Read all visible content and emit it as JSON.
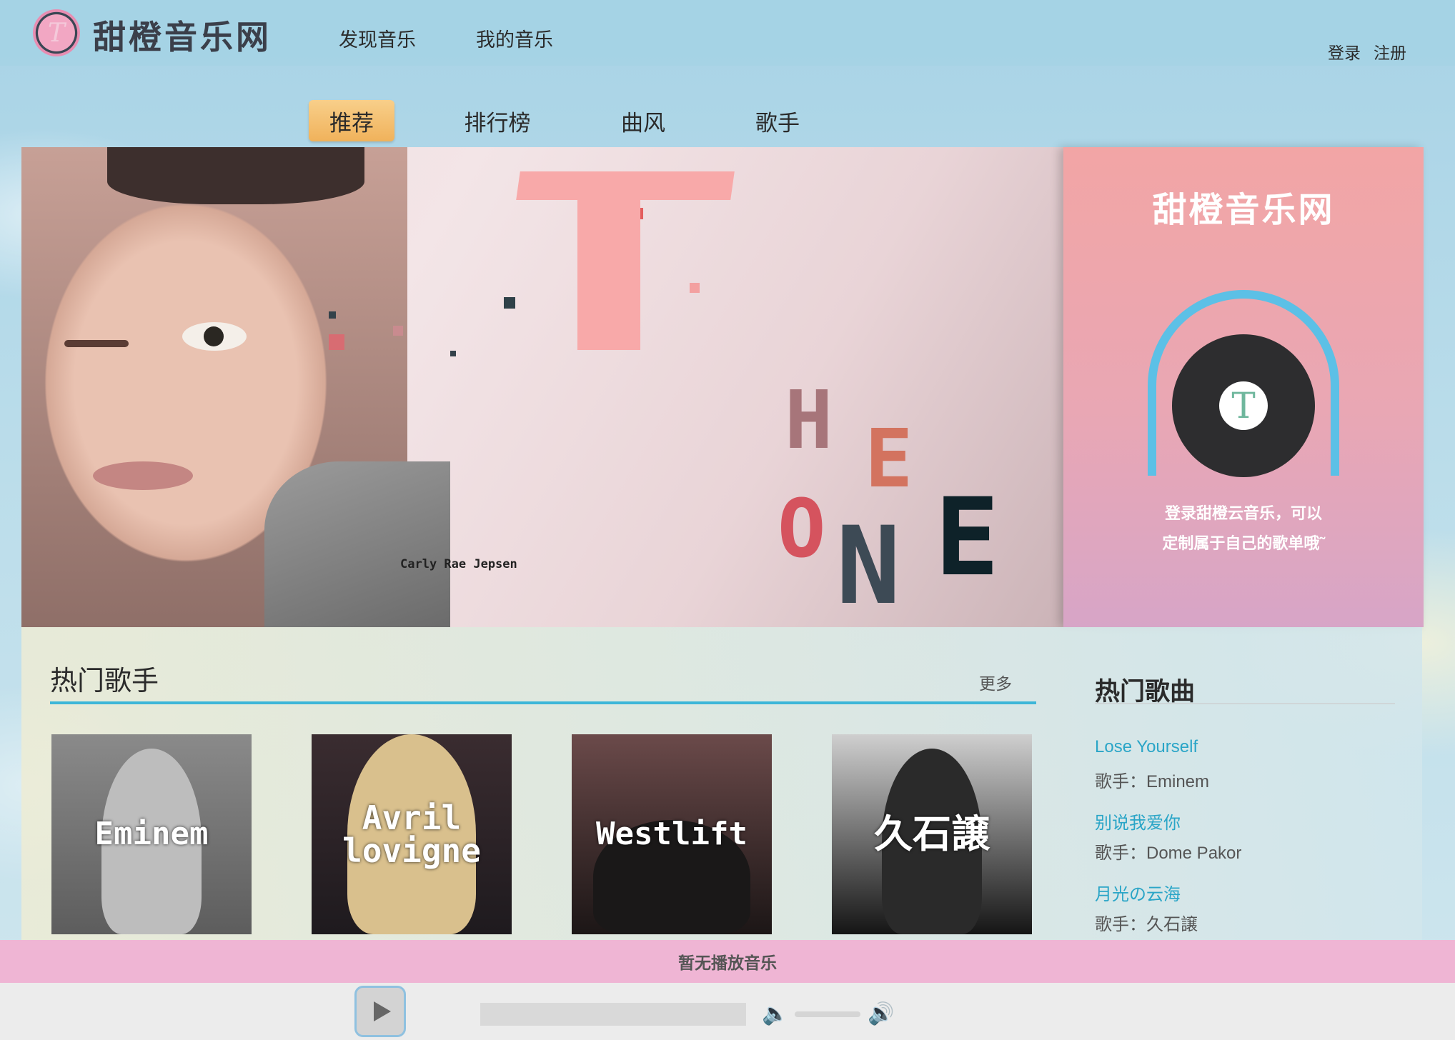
{
  "brand": {
    "name": "甜橙音乐网",
    "logo_letter": "T"
  },
  "topnav": {
    "items": [
      "发现音乐",
      "我的音乐"
    ],
    "login": "登录",
    "register": "注册"
  },
  "tabs": [
    {
      "label": "推荐",
      "active": true
    },
    {
      "label": "排行榜",
      "active": false
    },
    {
      "label": "曲风",
      "active": false
    },
    {
      "label": "歌手",
      "active": false
    }
  ],
  "banner": {
    "letters": [
      "T",
      "H",
      "E",
      "O",
      "N",
      "E"
    ],
    "credit": "Carly Rae Jepsen"
  },
  "promo": {
    "title": "甜橙音乐网",
    "line1": "登录甜橙云音乐，可以",
    "line2": "定制属于自己的歌单哦˜",
    "vinyl_letter": "T"
  },
  "hot_singers": {
    "title": "热门歌手",
    "more": "更多",
    "items": [
      {
        "name": "Eminem"
      },
      {
        "name": "Avril lovigne"
      },
      {
        "name": "Westlift"
      },
      {
        "name": "久石譲"
      }
    ]
  },
  "hot_songs": {
    "title": "热门歌曲",
    "items": [
      {
        "title": "Lose Yourself",
        "artist": "歌手：Eminem"
      },
      {
        "title": "别说我爱你",
        "artist": "歌手：Dome Pakor"
      },
      {
        "title": "月光の云海",
        "artist": "歌手：久石譲"
      }
    ]
  },
  "player": {
    "status": "暂无播放音乐"
  },
  "colors": {
    "accent": "#3db6d8",
    "tab_active": "#f0b25b",
    "player_bar": "#efb5d4",
    "link": "#2aa5c7"
  }
}
